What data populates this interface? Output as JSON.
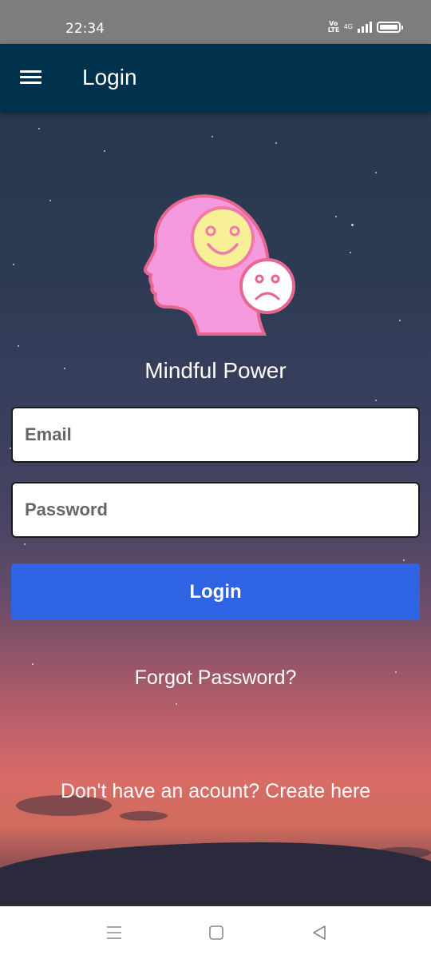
{
  "status_bar": {
    "time": "22:34",
    "volte_label": "Vo LTE",
    "network_label": "4G",
    "icons": [
      "volte-icon",
      "signal-icon",
      "battery-icon"
    ]
  },
  "app_bar": {
    "title": "Login",
    "menu_icon": "hamburger-menu-icon"
  },
  "main": {
    "logo_icon": "mind-emotions-logo",
    "app_name": "Mindful Power",
    "email_placeholder": "Email",
    "password_placeholder": "Password",
    "login_button": "Login",
    "forgot_password": "Forgot Password?",
    "signup_prompt": "Don't have an acount? Create here"
  },
  "nav_bar": {
    "icons": [
      "recents-icon",
      "home-icon",
      "back-icon"
    ]
  },
  "colors": {
    "app_bar": "#00314d",
    "status_bar": "#7d7d7d",
    "login_button": "#2e63e3",
    "logo_head": "#f59ade",
    "logo_smile_face": "#f8f097"
  }
}
